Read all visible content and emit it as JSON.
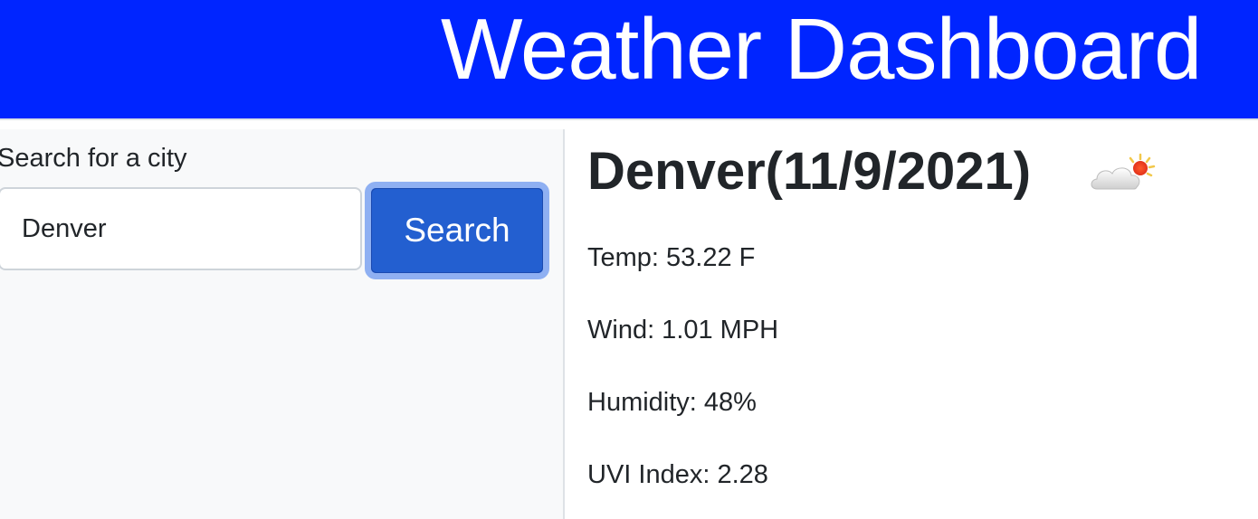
{
  "header": {
    "title": "Weather Dashboard"
  },
  "sidebar": {
    "search_label": "Search for a city",
    "search_input_value": "Denver",
    "search_button_label": "Search"
  },
  "current": {
    "heading": "Denver(11/9/2021)",
    "icon": "cloud-sun-icon",
    "temp": "Temp: 53.22 F",
    "wind": "Wind: 1.01 MPH",
    "humidity": "Humidity: 48%",
    "uvi": "UVI Index: 2.28"
  },
  "colors": {
    "header_bg": "#0025ff",
    "button_bg": "#235fd0",
    "button_focus_ring": "#8fb0f2",
    "sidebar_bg": "#f8f9fa"
  }
}
